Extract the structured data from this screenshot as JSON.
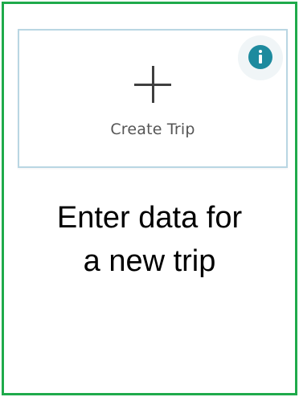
{
  "card": {
    "label": "Create Trip",
    "plus_icon": "plus-icon",
    "info_icon": "info-icon"
  },
  "caption": {
    "line1": "Enter data for",
    "line2": "a new trip"
  },
  "colors": {
    "frame_border": "#1faa4b",
    "card_border": "#b9d6e3",
    "info_icon": "#1d8a9e"
  }
}
